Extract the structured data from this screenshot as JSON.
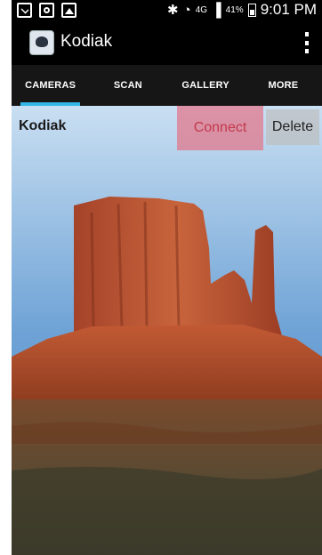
{
  "status_bar": {
    "network": "4G",
    "battery": "41%",
    "time": "9:01 PM"
  },
  "app": {
    "title": "Kodiak"
  },
  "tabs": [
    {
      "label": "CAMERAS",
      "active": true
    },
    {
      "label": "SCAN",
      "active": false
    },
    {
      "label": "GALLERY",
      "active": false
    },
    {
      "label": "MORE",
      "active": false
    }
  ],
  "camera": {
    "name": "Kodiak",
    "connect_label": "Connect",
    "delete_label": "Delete"
  },
  "colors": {
    "tab_indicator": "#33b5e5",
    "connect_bg": "#e2788c",
    "connect_text": "#c4384a"
  }
}
